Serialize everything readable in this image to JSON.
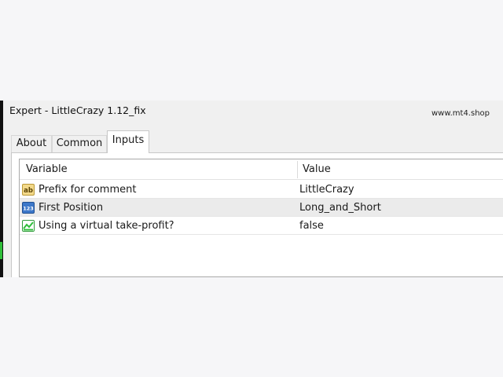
{
  "window": {
    "title": "Expert - LittleCrazy 1.12_fix",
    "watermark": "www.mt4.shop"
  },
  "tabs": [
    {
      "label": "About"
    },
    {
      "label": "Common"
    },
    {
      "label": "Inputs",
      "active": true
    }
  ],
  "table": {
    "columns": [
      "Variable",
      "Value"
    ],
    "rows": [
      {
        "icon": "text-ab-icon",
        "variable": "Prefix for comment",
        "value": "LittleCrazy"
      },
      {
        "icon": "numeric-123-icon",
        "variable": "First Position",
        "value": "Long_and_Short",
        "selected": true
      },
      {
        "icon": "chart-toggle-icon",
        "variable": "Using a virtual take-profit?",
        "value": "false"
      }
    ]
  },
  "icon_glyphs": {
    "ab": "ab",
    "num": "123"
  },
  "colors": {
    "selected_row": "#ebebeb",
    "chart_green": "#2fbf3a"
  }
}
